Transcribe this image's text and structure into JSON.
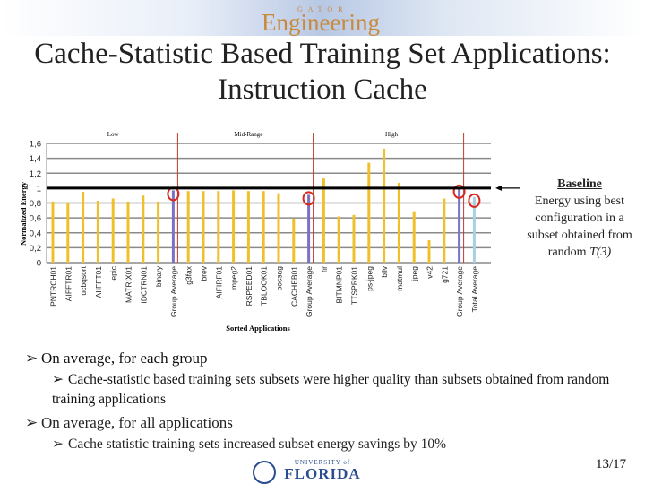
{
  "header": {
    "logo_small": "GATOR",
    "logo_main": "Engineering"
  },
  "title": "Cache-Statistic Based Training Set Applications: Instruction Cache",
  "baseline_note": {
    "heading": "Baseline",
    "text": "Energy using best configuration in a subset obtained from random",
    "ref": "T(3)"
  },
  "bullets": [
    {
      "text": "On average, for each group",
      "sub": "Cache-statistic based training sets subsets were higher quality than subsets obtained from random training applications"
    },
    {
      "text": "On average, for all applications",
      "sub": "Cache statistic training sets increased subset energy savings by 10%"
    }
  ],
  "footer": {
    "university": "UNIVERSITY of",
    "name": "FLORIDA"
  },
  "page_number": "13/17",
  "colors": {
    "app_bar": "#f0c02a",
    "group_avg": "#7b72c4",
    "total_avg": "#a8d0e0",
    "baseline": "#000000",
    "separator": "#c0392b",
    "highlight": "#d9261c"
  },
  "chart_data": {
    "type": "bar",
    "ylabel": "Normalized Energy",
    "xlabel": "Sorted Applications",
    "ylim": [
      0,
      1.6
    ],
    "yticks": [
      "0",
      "0,2",
      "0,4",
      "0,6",
      "0,8",
      "1",
      "1,2",
      "1,4",
      "1,6"
    ],
    "grid": true,
    "baseline": 1,
    "groups": [
      {
        "label": "Low",
        "categories": [
          "PNTRCH01",
          "AIFFTR01",
          "ucbqsort",
          "AIIFFT01",
          "epic",
          "MATRIX01",
          "IDCTRN01",
          "binary",
          "Group Average"
        ],
        "values": [
          0.82,
          0.8,
          0.95,
          0.83,
          0.86,
          0.82,
          0.9,
          0.82,
          0.97
        ]
      },
      {
        "label": "Mid-Range",
        "categories": [
          "g3fax",
          "brev",
          "AIFIRF01",
          "mpeg2",
          "RSPEED01",
          "TBLOOK01",
          "pocsag",
          "CACHEB01",
          "Group Average"
        ],
        "values": [
          0.96,
          0.96,
          0.96,
          0.97,
          0.96,
          0.96,
          0.93,
          0.59,
          0.91
        ]
      },
      {
        "label": "High",
        "categories": [
          "fir",
          "BITMNP01",
          "TTSPRK01",
          "ps-jpeg",
          "bilv",
          "matmul",
          "jpeg",
          "v42",
          "g721",
          "Group Average"
        ],
        "values": [
          1.13,
          0.62,
          0.64,
          1.34,
          1.53,
          1.07,
          0.69,
          0.3,
          0.86,
          1.0
        ]
      }
    ],
    "total": {
      "category": "Total Average",
      "value": 0.88
    }
  }
}
